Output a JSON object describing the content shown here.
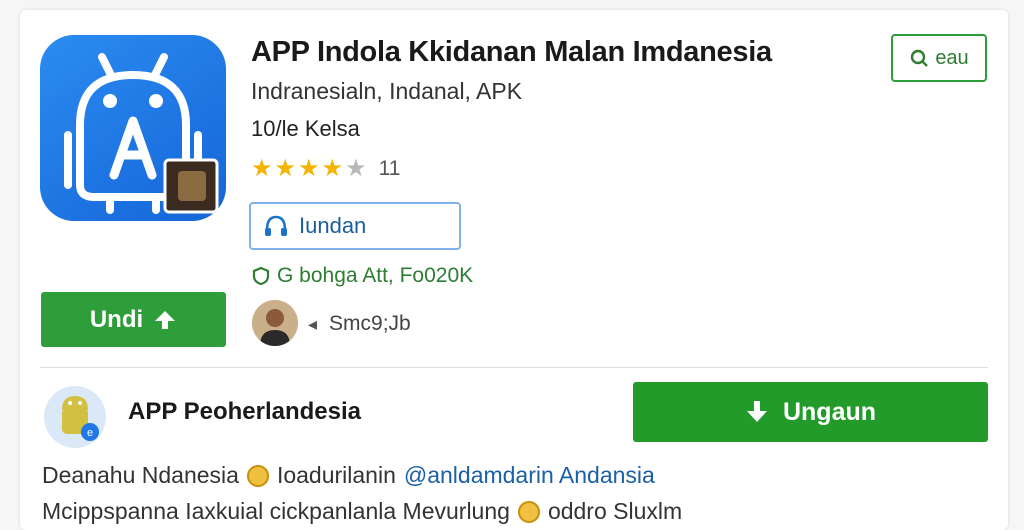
{
  "app": {
    "title": "APP Indola Kkidanan Malan Imdanesia",
    "subtitle": "Indranesialn, Indanal, APK",
    "category": "10/le Kelsa",
    "rating_value": 4,
    "rating_max": 5,
    "rating_count": "11",
    "outline_button_label": "Iundan",
    "meta_line": "G bohga Att, Fo020K",
    "install_button_label": "Undi",
    "developer_line": "Smc9;Jb",
    "save_button_label": "eau",
    "icon": "android-a-letter-icon"
  },
  "second": {
    "title": "APP Peoherlandesia",
    "download_button_label": "Ungaun",
    "icon": "android-small-icon"
  },
  "description": {
    "line1_text": "Deanahu Ndanesia",
    "line1_mid": "Ioadurilanin",
    "line1_link": "@anldamdarin Andansia",
    "line2_text": "Mcippspanna Iaxkuial cickpanlanla Mevurlung",
    "line2_tail": "oddro Sluxlm"
  },
  "colors": {
    "primary_green": "#2e9e3a",
    "download_green": "#239b2b",
    "star": "#f4b400",
    "link_blue": "#1a5fa8",
    "icon_blue": "#1f78e6"
  }
}
